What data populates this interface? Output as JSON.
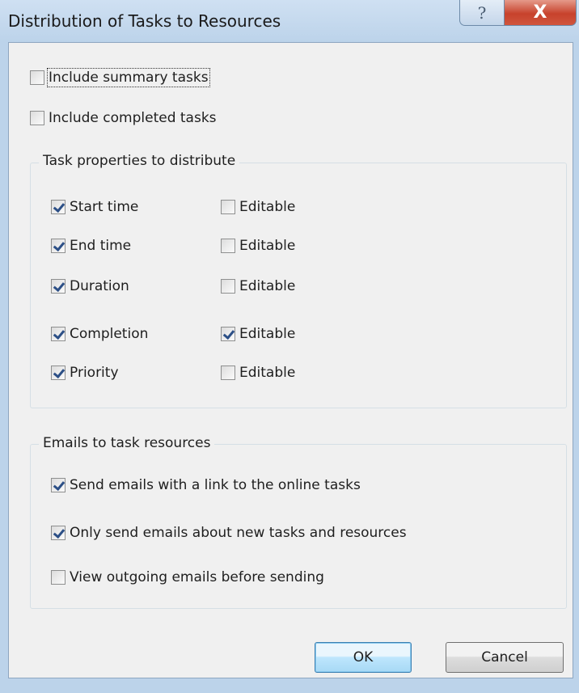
{
  "window": {
    "title": "Distribution of Tasks to Resources",
    "help_glyph": "?",
    "close_glyph": "X"
  },
  "options": {
    "include_summary": {
      "label": "Include summary tasks",
      "checked": false
    },
    "include_completed": {
      "label": "Include completed tasks",
      "checked": false
    }
  },
  "task_properties": {
    "title": "Task properties to distribute",
    "rows": [
      {
        "label": "Start time",
        "checked": true,
        "editable_label": "Editable",
        "editable": false
      },
      {
        "label": "End time",
        "checked": true,
        "editable_label": "Editable",
        "editable": false
      },
      {
        "label": "Duration",
        "checked": true,
        "editable_label": "Editable",
        "editable": false
      },
      {
        "label": "Completion",
        "checked": true,
        "editable_label": "Editable",
        "editable": true
      },
      {
        "label": "Priority",
        "checked": true,
        "editable_label": "Editable",
        "editable": false
      }
    ]
  },
  "emails": {
    "title": "Emails to task resources",
    "items": [
      {
        "label": "Send emails with a link to the online tasks",
        "checked": true
      },
      {
        "label": "Only send emails about new tasks and resources",
        "checked": true
      },
      {
        "label": "View outgoing emails before sending",
        "checked": false
      }
    ]
  },
  "buttons": {
    "ok": "OK",
    "cancel": "Cancel"
  }
}
